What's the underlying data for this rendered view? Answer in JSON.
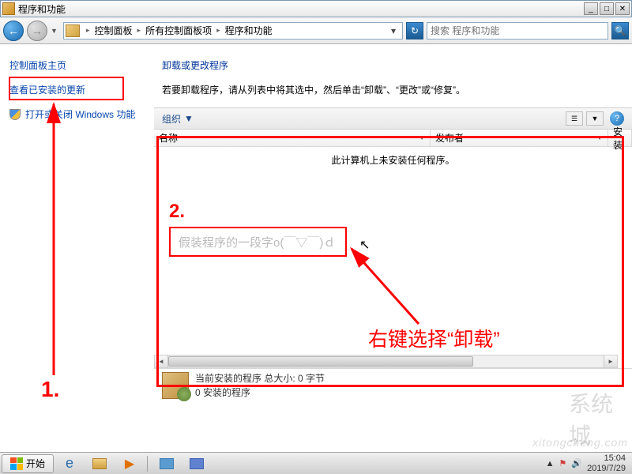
{
  "title": "程序和功能",
  "breadcrumb": {
    "root": "控制面板",
    "mid": "所有控制面板项",
    "leaf": "程序和功能"
  },
  "search_placeholder": "搜索 程序和功能",
  "sidebar": {
    "home": "控制面板主页",
    "updates": "查看已安装的更新",
    "winfeat": "打开或关闭 Windows 功能"
  },
  "main": {
    "heading": "卸载或更改程序",
    "subtitle": "若要卸载程序，请从列表中将其选中，然后单击“卸载”、“更改”或“修复”。",
    "organize": "组织",
    "col_name": "名称",
    "col_publisher": "发布者",
    "col_install": "安装",
    "empty_msg": "此计算机上未安装任何程序。"
  },
  "status": {
    "line1": "当前安装的程序  总大小: 0 字节",
    "line2": "0 安装的程序"
  },
  "taskbar": {
    "start": "开始",
    "time": "15:04",
    "date": "2019/7/29"
  },
  "annot": {
    "num1": "1.",
    "num2": "2.",
    "fake_text": "假装程序的一段字o(￣▽￣)ｄ",
    "hint": "右键选择“卸载”"
  },
  "watermark": "xitongcheng.com",
  "wmlogo": "系统城"
}
